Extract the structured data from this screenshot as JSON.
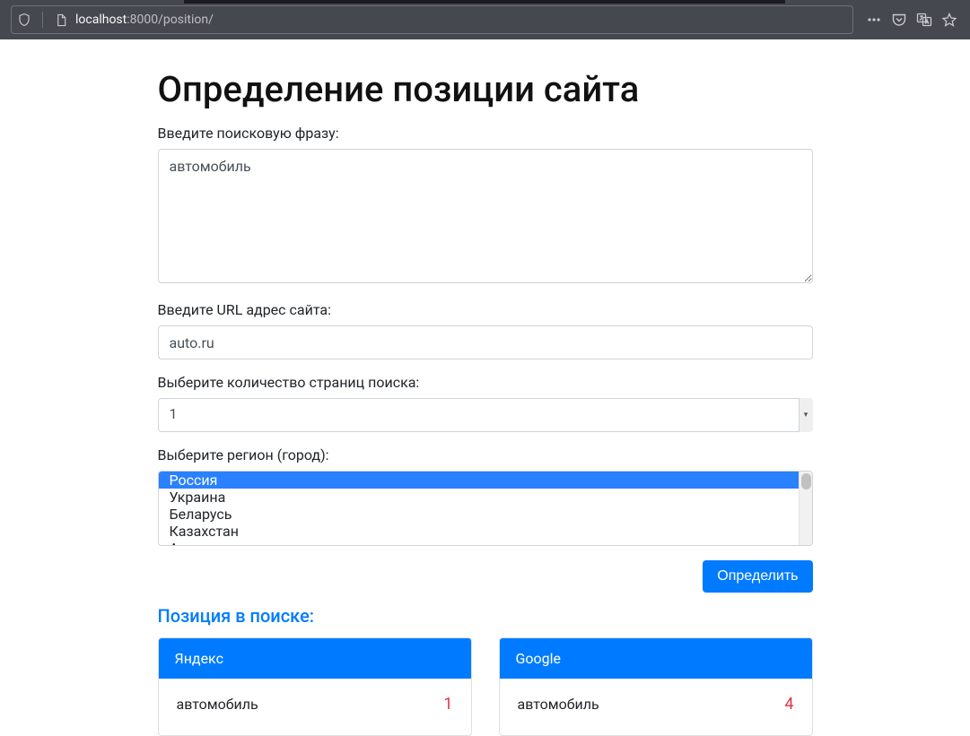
{
  "browser": {
    "host": "localhost",
    "rest": ":8000/position/"
  },
  "page": {
    "title": "Определение позиции сайта"
  },
  "form": {
    "phrase_label": "Введите поисковую фразу:",
    "phrase_value": "автомобиль",
    "url_label": "Введите URL адрес сайта:",
    "url_value": "auto.ru",
    "pages_label": "Выберите количество страниц поиска:",
    "pages_value": "1",
    "region_label": "Выберите регион (город):",
    "region_options": [
      "Россия",
      "Украина",
      "Беларусь",
      "Казахстан",
      "А"
    ],
    "region_selected_index": 0,
    "submit_label": "Определить"
  },
  "results": {
    "heading": "Позиция в поиске:",
    "cards": [
      {
        "engine": "Яндекс",
        "term": "автомобиль",
        "position": "1"
      },
      {
        "engine": "Google",
        "term": "автомобиль",
        "position": "4"
      }
    ]
  }
}
